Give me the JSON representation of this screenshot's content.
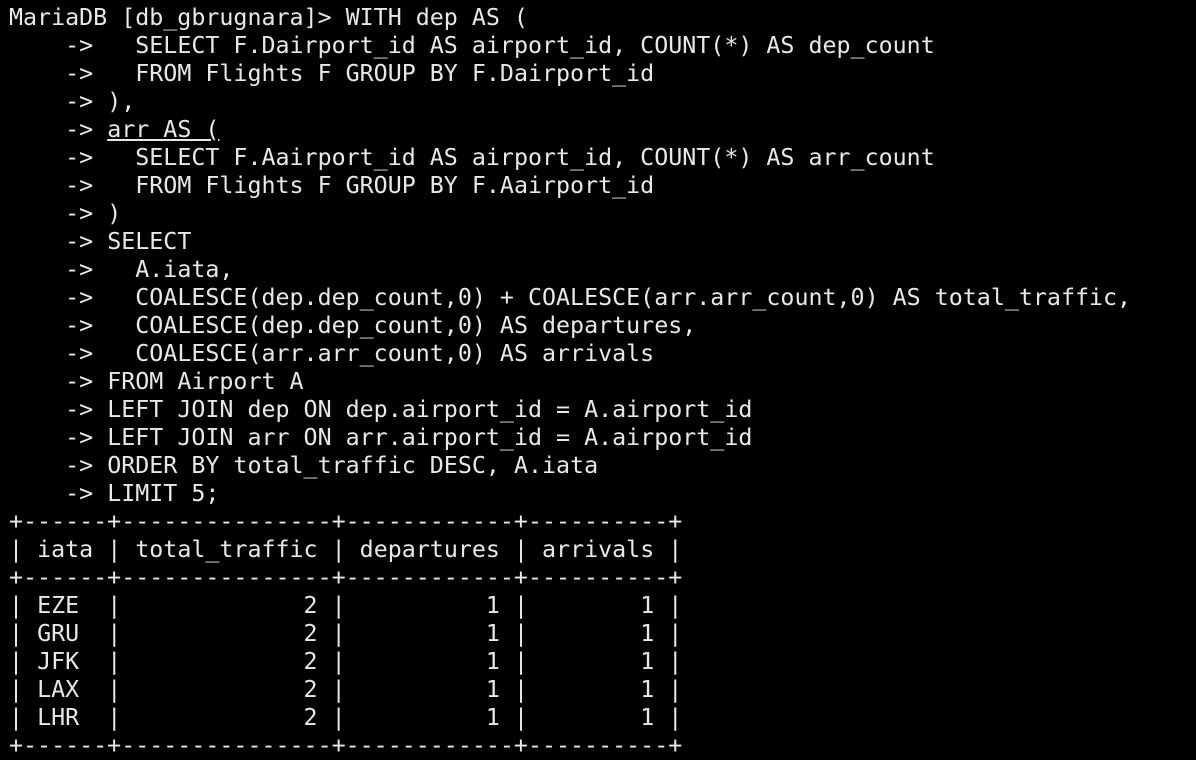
{
  "terminal": {
    "prompt": "MariaDB [db_gbrugnara]> ",
    "continuation": "    -> ",
    "query_lines": [
      "WITH dep AS (",
      "  SELECT F.Dairport_id AS airport_id, COUNT(*) AS dep_count",
      "  FROM Flights F GROUP BY F.Dairport_id",
      "),",
      "arr AS (",
      "  SELECT F.Aairport_id AS airport_id, COUNT(*) AS arr_count",
      "  FROM Flights F GROUP BY F.Aairport_id",
      ")",
      "SELECT",
      "  A.iata,",
      "  COALESCE(dep.dep_count,0) + COALESCE(arr.arr_count,0) AS total_traffic,",
      "  COALESCE(dep.dep_count,0) AS departures,",
      "  COALESCE(arr.arr_count,0) AS arrivals",
      "FROM Airport A",
      "LEFT JOIN dep ON dep.airport_id = A.airport_id",
      "LEFT JOIN arr ON arr.airport_id = A.airport_id",
      "ORDER BY total_traffic DESC, A.iata",
      "LIMIT 5;"
    ],
    "result": {
      "columns": [
        "iata",
        "total_traffic",
        "departures",
        "arrivals"
      ],
      "rows": [
        [
          "EZE",
          "2",
          "1",
          "1"
        ],
        [
          "GRU",
          "2",
          "1",
          "1"
        ],
        [
          "JFK",
          "2",
          "1",
          "1"
        ],
        [
          "LAX",
          "2",
          "1",
          "1"
        ],
        [
          "LHR",
          "2",
          "1",
          "1"
        ]
      ]
    }
  }
}
